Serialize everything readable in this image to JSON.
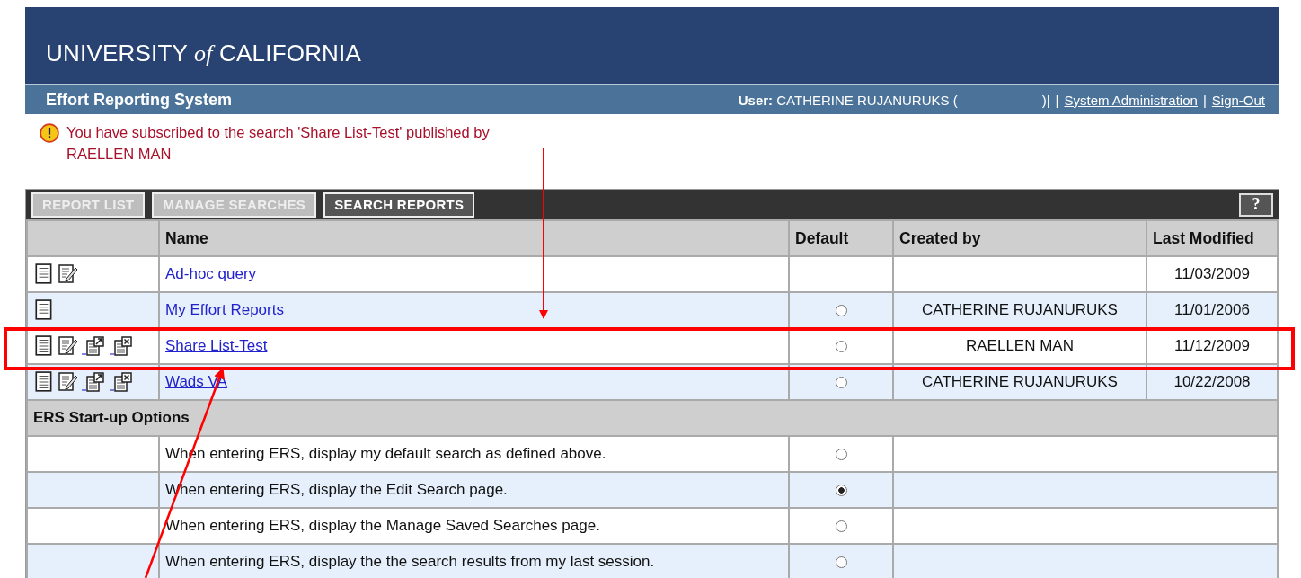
{
  "header": {
    "brand_before": "UNIVERSITY",
    "brand_italic": "of",
    "brand_after": "CALIFORNIA"
  },
  "sub_bar": {
    "title": "Effort Reporting System",
    "user_label": "User:",
    "user_name": "CATHERINE RUJANURUKS (",
    "items": [
      {
        "kind": "text",
        "text": ")|"
      },
      {
        "kind": "text",
        "text": "|"
      },
      {
        "kind": "link",
        "text": "System Administration"
      },
      {
        "kind": "text",
        "text": "|"
      },
      {
        "kind": "link",
        "text": "Sign-Out"
      }
    ]
  },
  "message": {
    "lines": [
      "You have subscribed to the search 'Share List-Test' published by",
      "RAELLEN MAN"
    ]
  },
  "toolbar": {
    "tabs": [
      {
        "label": "REPORT LIST",
        "kind": "light"
      },
      {
        "label": "MANAGE SEARCHES",
        "kind": "light"
      },
      {
        "label": "SEARCH REPORTS",
        "kind": "dark"
      }
    ],
    "help": "?"
  },
  "table": {
    "columns": [
      "Name",
      "Default",
      "Created by",
      "Last Modified"
    ],
    "rows": [
      {
        "icons": [
          {
            "kind": "list"
          },
          {
            "kind": "edit"
          }
        ],
        "name": "Ad-hoc query",
        "created_by": "",
        "last_modified": "11/03/2009"
      },
      {
        "icons": [
          {
            "kind": "list"
          }
        ],
        "name": "My Effort Reports",
        "default_radio": {
          "selected": false
        },
        "created_by": "CATHERINE RUJANURUKS",
        "last_modified": "11/01/2006"
      },
      {
        "icons": [
          {
            "kind": "list"
          },
          {
            "kind": "edit"
          },
          {
            "kind": "export"
          },
          {
            "kind": "delete"
          }
        ],
        "name": "Share List-Test",
        "default_radio": {
          "selected": false
        },
        "created_by": "RAELLEN MAN",
        "last_modified": "11/12/2009"
      },
      {
        "icons": [
          {
            "kind": "list"
          },
          {
            "kind": "edit"
          },
          {
            "kind": "export"
          },
          {
            "kind": "delete"
          }
        ],
        "name": "Wads VA",
        "default_radio": {
          "selected": false
        },
        "created_by": "CATHERINE RUJANURUKS",
        "last_modified": "10/22/2008"
      }
    ]
  },
  "startup": {
    "title": "ERS Start-up Options",
    "options": [
      {
        "text": "When entering ERS, display my default search as defined above.",
        "selected": false
      },
      {
        "text": "When entering ERS, display the Edit Search page.",
        "selected": true
      },
      {
        "text": "When entering ERS, display the Manage Saved Searches page.",
        "selected": false
      },
      {
        "text": "When entering ERS, display the the search results from my last session.",
        "selected": false
      }
    ]
  }
}
